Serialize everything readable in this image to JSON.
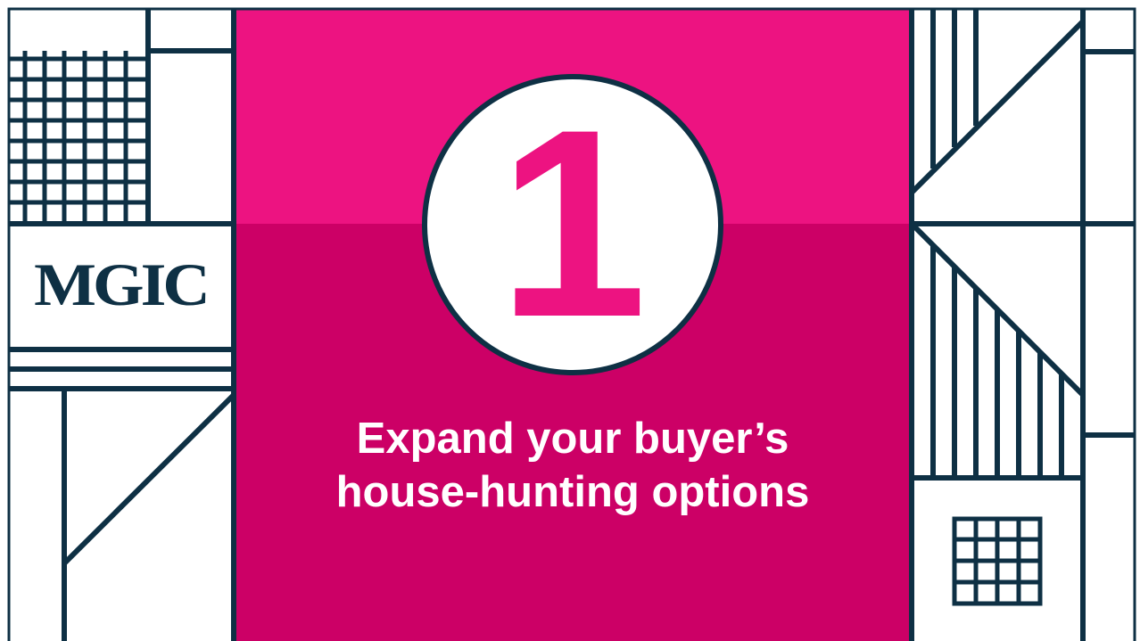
{
  "slide": {
    "number": "1",
    "headline_lines": [
      "Expand your buyer’s",
      "house-hunting options"
    ]
  },
  "brand": {
    "logo_text": "MGIC"
  },
  "colors": {
    "navy": "#0e3044",
    "bright_pink": "#ed1381",
    "deep_pink": "#cc0066",
    "white": "#ffffff"
  }
}
